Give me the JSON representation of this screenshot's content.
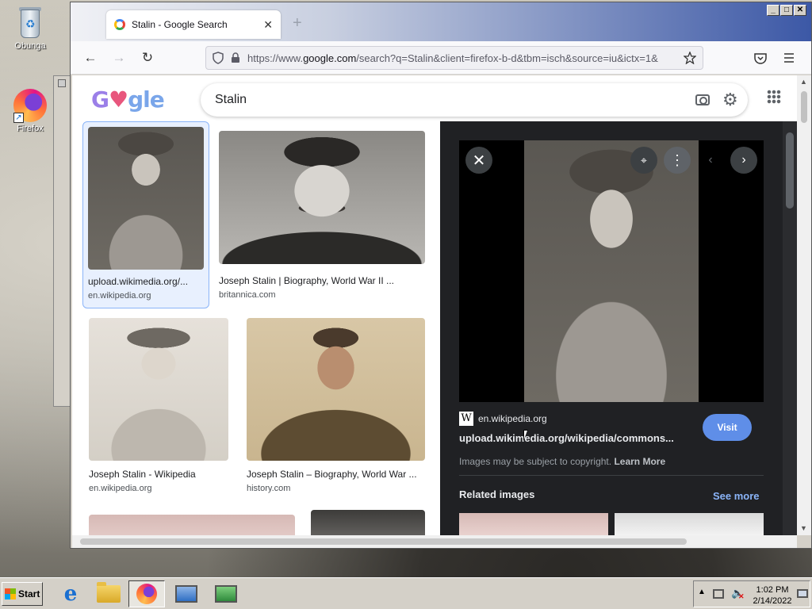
{
  "desktop": {
    "icons": [
      {
        "label": "Obunga",
        "icon": "recycle-bin-icon"
      },
      {
        "label": "Firefox",
        "icon": "firefox-icon"
      }
    ]
  },
  "browser": {
    "tab": {
      "title": "Stalin - Google Search",
      "close": "✕",
      "new_tab": "+"
    },
    "window_controls": {
      "minimize": "_",
      "maximize": "□",
      "close": "✕"
    },
    "nav": {
      "back": "←",
      "forward": "→",
      "reload": "↻"
    },
    "url": {
      "prefix": "https://www.",
      "host": "google.com",
      "path": "/search?q=Stalin&client=firefox-b-d&tbm=isch&source=iu&ictx=1&"
    },
    "toolbar_icons": [
      "pocket-icon",
      "menu-icon"
    ]
  },
  "google": {
    "logo": {
      "g": "G",
      "heart": "♥",
      "rest": "gle"
    },
    "search": {
      "query": "Stalin"
    },
    "results": [
      {
        "caption": "upload.wikimedia.org/...",
        "source": "en.wikipedia.org",
        "selected": true
      },
      {
        "caption": "Joseph Stalin | Biography, World War II ...",
        "source": "britannica.com",
        "selected": false
      },
      {
        "caption": "Joseph Stalin - Wikipedia",
        "source": "en.wikipedia.org",
        "selected": false
      },
      {
        "caption": "Joseph Stalin – Biography, World War ...",
        "source": "history.com",
        "selected": false
      }
    ],
    "preview": {
      "site": "en.wikipedia.org",
      "site_logo": "W",
      "title": "upload.wikimedia.org/wikipedia/commons...",
      "visit_label": "Visit",
      "copyright": "Images may be subject to copyright.",
      "learn_more": "Learn More",
      "related_title": "Related images",
      "see_more": "See more",
      "close_glyph": "✕",
      "more_glyph": "⋮",
      "prev_glyph": "‹",
      "next_glyph": "›"
    }
  },
  "taskbar": {
    "start_label": "Start",
    "clock_time": "1:02 PM",
    "clock_date": "2/14/2022"
  }
}
